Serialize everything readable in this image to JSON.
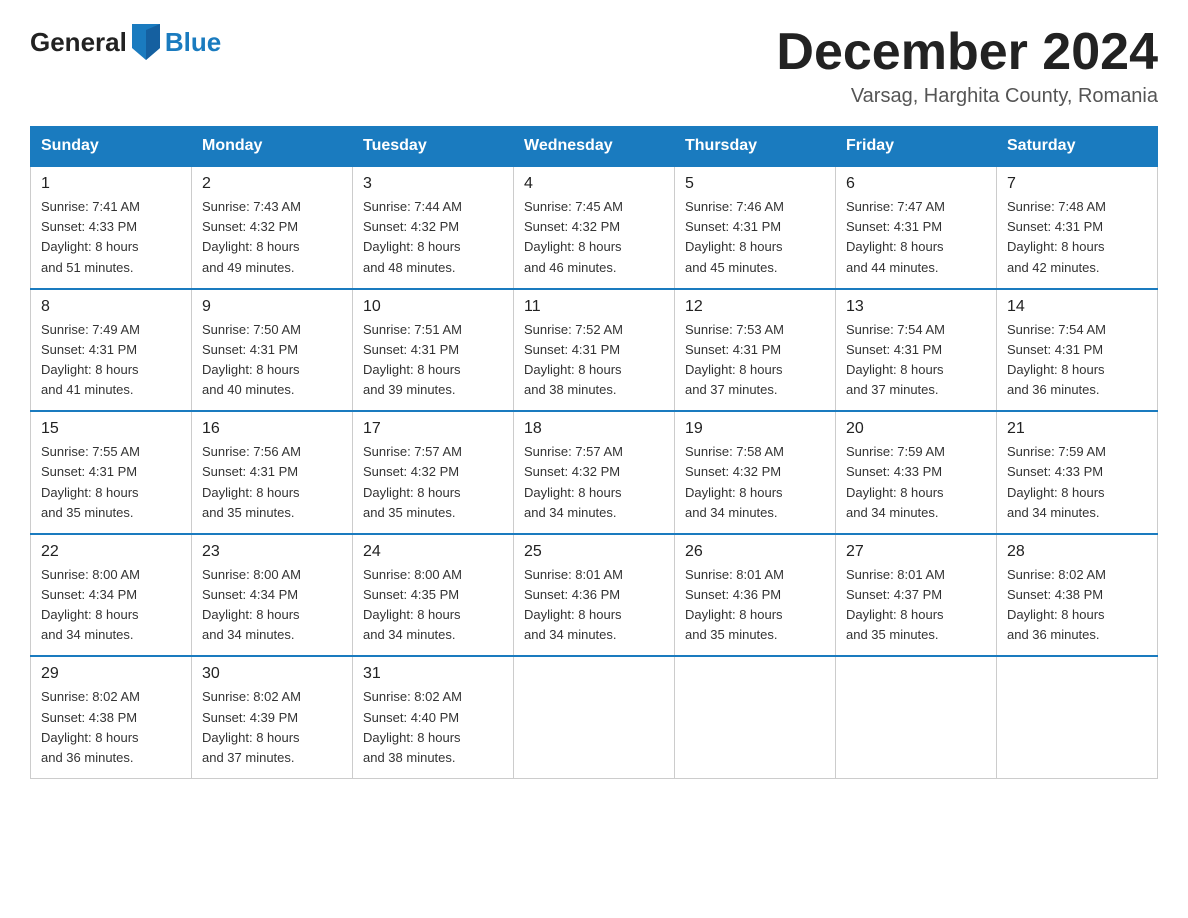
{
  "header": {
    "logo_general": "General",
    "logo_blue": "Blue",
    "month_title": "December 2024",
    "location": "Varsag, Harghita County, Romania"
  },
  "weekdays": [
    "Sunday",
    "Monday",
    "Tuesday",
    "Wednesday",
    "Thursday",
    "Friday",
    "Saturday"
  ],
  "weeks": [
    [
      {
        "day": "1",
        "sunrise": "7:41 AM",
        "sunset": "4:33 PM",
        "daylight": "8 hours and 51 minutes."
      },
      {
        "day": "2",
        "sunrise": "7:43 AM",
        "sunset": "4:32 PM",
        "daylight": "8 hours and 49 minutes."
      },
      {
        "day": "3",
        "sunrise": "7:44 AM",
        "sunset": "4:32 PM",
        "daylight": "8 hours and 48 minutes."
      },
      {
        "day": "4",
        "sunrise": "7:45 AM",
        "sunset": "4:32 PM",
        "daylight": "8 hours and 46 minutes."
      },
      {
        "day": "5",
        "sunrise": "7:46 AM",
        "sunset": "4:31 PM",
        "daylight": "8 hours and 45 minutes."
      },
      {
        "day": "6",
        "sunrise": "7:47 AM",
        "sunset": "4:31 PM",
        "daylight": "8 hours and 44 minutes."
      },
      {
        "day": "7",
        "sunrise": "7:48 AM",
        "sunset": "4:31 PM",
        "daylight": "8 hours and 42 minutes."
      }
    ],
    [
      {
        "day": "8",
        "sunrise": "7:49 AM",
        "sunset": "4:31 PM",
        "daylight": "8 hours and 41 minutes."
      },
      {
        "day": "9",
        "sunrise": "7:50 AM",
        "sunset": "4:31 PM",
        "daylight": "8 hours and 40 minutes."
      },
      {
        "day": "10",
        "sunrise": "7:51 AM",
        "sunset": "4:31 PM",
        "daylight": "8 hours and 39 minutes."
      },
      {
        "day": "11",
        "sunrise": "7:52 AM",
        "sunset": "4:31 PM",
        "daylight": "8 hours and 38 minutes."
      },
      {
        "day": "12",
        "sunrise": "7:53 AM",
        "sunset": "4:31 PM",
        "daylight": "8 hours and 37 minutes."
      },
      {
        "day": "13",
        "sunrise": "7:54 AM",
        "sunset": "4:31 PM",
        "daylight": "8 hours and 37 minutes."
      },
      {
        "day": "14",
        "sunrise": "7:54 AM",
        "sunset": "4:31 PM",
        "daylight": "8 hours and 36 minutes."
      }
    ],
    [
      {
        "day": "15",
        "sunrise": "7:55 AM",
        "sunset": "4:31 PM",
        "daylight": "8 hours and 35 minutes."
      },
      {
        "day": "16",
        "sunrise": "7:56 AM",
        "sunset": "4:31 PM",
        "daylight": "8 hours and 35 minutes."
      },
      {
        "day": "17",
        "sunrise": "7:57 AM",
        "sunset": "4:32 PM",
        "daylight": "8 hours and 35 minutes."
      },
      {
        "day": "18",
        "sunrise": "7:57 AM",
        "sunset": "4:32 PM",
        "daylight": "8 hours and 34 minutes."
      },
      {
        "day": "19",
        "sunrise": "7:58 AM",
        "sunset": "4:32 PM",
        "daylight": "8 hours and 34 minutes."
      },
      {
        "day": "20",
        "sunrise": "7:59 AM",
        "sunset": "4:33 PM",
        "daylight": "8 hours and 34 minutes."
      },
      {
        "day": "21",
        "sunrise": "7:59 AM",
        "sunset": "4:33 PM",
        "daylight": "8 hours and 34 minutes."
      }
    ],
    [
      {
        "day": "22",
        "sunrise": "8:00 AM",
        "sunset": "4:34 PM",
        "daylight": "8 hours and 34 minutes."
      },
      {
        "day": "23",
        "sunrise": "8:00 AM",
        "sunset": "4:34 PM",
        "daylight": "8 hours and 34 minutes."
      },
      {
        "day": "24",
        "sunrise": "8:00 AM",
        "sunset": "4:35 PM",
        "daylight": "8 hours and 34 minutes."
      },
      {
        "day": "25",
        "sunrise": "8:01 AM",
        "sunset": "4:36 PM",
        "daylight": "8 hours and 34 minutes."
      },
      {
        "day": "26",
        "sunrise": "8:01 AM",
        "sunset": "4:36 PM",
        "daylight": "8 hours and 35 minutes."
      },
      {
        "day": "27",
        "sunrise": "8:01 AM",
        "sunset": "4:37 PM",
        "daylight": "8 hours and 35 minutes."
      },
      {
        "day": "28",
        "sunrise": "8:02 AM",
        "sunset": "4:38 PM",
        "daylight": "8 hours and 36 minutes."
      }
    ],
    [
      {
        "day": "29",
        "sunrise": "8:02 AM",
        "sunset": "4:38 PM",
        "daylight": "8 hours and 36 minutes."
      },
      {
        "day": "30",
        "sunrise": "8:02 AM",
        "sunset": "4:39 PM",
        "daylight": "8 hours and 37 minutes."
      },
      {
        "day": "31",
        "sunrise": "8:02 AM",
        "sunset": "4:40 PM",
        "daylight": "8 hours and 38 minutes."
      },
      null,
      null,
      null,
      null
    ]
  ]
}
